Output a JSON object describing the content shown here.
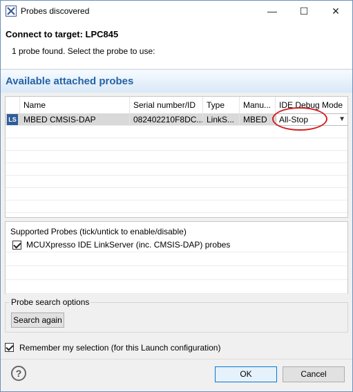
{
  "window": {
    "title": "Probes discovered",
    "controls": {
      "minimize": "—",
      "maximize": "☐",
      "close": "✕"
    }
  },
  "header": {
    "title": "Connect to target: LPC845",
    "description": "1 probe found. Select the probe to use:"
  },
  "section": {
    "title": "Available attached probes"
  },
  "probe_table": {
    "columns": [
      "Name",
      "Serial number/ID",
      "Type",
      "Manu...",
      "IDE Debug Mode"
    ],
    "rows": [
      {
        "icon": "linkserver-icon",
        "icon_text": "LS",
        "name": "MBED CMSIS-DAP",
        "serial": "082402210F8DC...",
        "type": "LinkS...",
        "manufacturer": "MBED",
        "debug_mode": "All-Stop",
        "selected": true
      }
    ],
    "highlight_color": "#d21f1f"
  },
  "supported_probes": {
    "title": "Supported Probes (tick/untick to enable/disable)",
    "items": [
      {
        "label": "MCUXpresso IDE LinkServer (inc. CMSIS-DAP) probes",
        "checked": true
      }
    ]
  },
  "search_options": {
    "legend": "Probe search options",
    "button": "Search again"
  },
  "remember": {
    "label": "Remember my selection (for this Launch configuration)",
    "checked": true
  },
  "footer": {
    "help_icon": "?",
    "ok": "OK",
    "cancel": "Cancel"
  },
  "colors": {
    "accent": "#2563a7",
    "selection": "#d9d9d9"
  }
}
